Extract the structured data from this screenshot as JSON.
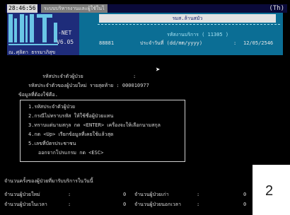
{
  "titlebar": {
    "time": "28:46:56",
    "title": "ระบบบริหารงานและผู้ใช้ในไ",
    "right": "(Th)"
  },
  "logo": {
    "product": "-NET",
    "version": "V6.05",
    "company": "ณ.ศุลิตา ธรรมาภิสุข"
  },
  "header": {
    "title": "รมส.ล้านสมัว",
    "subtitle": "รหัสงานบริการ ( 11305 )",
    "code": "88881",
    "date_label": "ประจำวันที่ (dd/mm/yyyy)",
    "colon": ":",
    "date": "12/05/2546"
  },
  "form": {
    "row1_label": "รหัสประจำตัวผู้ป่วย",
    "row1_colon": ":",
    "row2_label": "รหัสประจำตัวของผู้ป่วยใหม่ รายสุดท้าย : 000010977"
  },
  "menu": {
    "heading": "ข้อมูลที่ต้องใช้คือ.",
    "items": [
      "1.รหัสประจำตัวผู้ป่วย",
      "2.กรณีไม่ทราบรหัส ให้ใช้ชื่อผู้ป่วยแทน",
      "3.ทราบแต่นามสกุล กด <ENTER> เครื่องจะให้เลือกนามสกุล",
      "4.กด <Up> เรียกข้อมูลที่เคยใช้แล้วสุด",
      "5.เลขที่บัตรประชาชน",
      "ออกจากโปรแกรม กด <ESC>"
    ]
  },
  "footer": {
    "summary": "จำนวนครั้งของผู้ป่วยที่มารับบริการในวันนี้",
    "left": [
      {
        "label": "จำนวนผู้ป่วยใหม่",
        "colon": ":",
        "value": "0"
      },
      {
        "label": "จำนวนผู้ป่วยในเวลา",
        "colon": ":",
        "value": "0"
      }
    ],
    "right": [
      {
        "label": "จำนวนผู้ป่วยเก่า",
        "colon": ":",
        "value": "0"
      },
      {
        "label": "จำนวนผู้ป่วยนอกเวลา",
        "colon": ":",
        "value": "0"
      }
    ]
  },
  "page_number": "2"
}
